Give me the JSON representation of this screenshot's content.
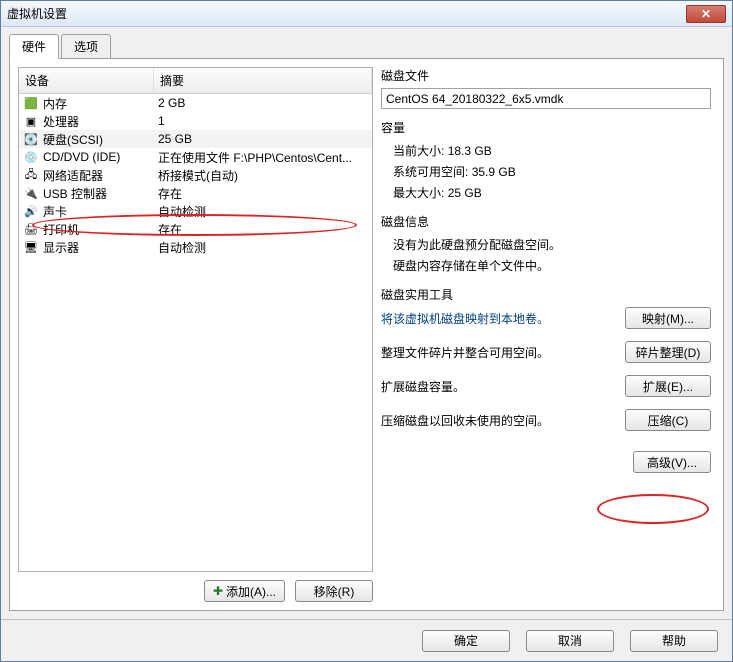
{
  "window": {
    "title": "虚拟机设置",
    "close_glyph": "✕"
  },
  "tabs": {
    "hardware": "硬件",
    "options": "选项"
  },
  "device_table": {
    "head_device": "设备",
    "head_summary": "摘要",
    "rows": [
      {
        "icon": "🟩",
        "name": "内存",
        "summary": "2 GB"
      },
      {
        "icon": "▣",
        "name": "处理器",
        "summary": "1"
      },
      {
        "icon": "💽",
        "name": "硬盘(SCSI)",
        "summary": "25 GB",
        "selected": true
      },
      {
        "icon": "💿",
        "name": "CD/DVD (IDE)",
        "summary": "正在使用文件 F:\\PHP\\Centos\\Cent..."
      },
      {
        "icon": "🖧",
        "name": "网络适配器",
        "summary": "桥接模式(自动)"
      },
      {
        "icon": "🔌",
        "name": "USB 控制器",
        "summary": "存在"
      },
      {
        "icon": "🔊",
        "name": "声卡",
        "summary": "自动检测"
      },
      {
        "icon": "🖨",
        "name": "打印机",
        "summary": "存在"
      },
      {
        "icon": "🖥",
        "name": "显示器",
        "summary": "自动检测"
      }
    ]
  },
  "left_buttons": {
    "add": "添加(A)...",
    "remove": "移除(R)"
  },
  "disk_file": {
    "label": "磁盘文件",
    "value": "CentOS 64_20180322_6x5.vmdk"
  },
  "capacity": {
    "label": "容量",
    "current_size_label": "当前大小:",
    "current_size": "18.3 GB",
    "free_label": "系统可用空间:",
    "free": "35.9 GB",
    "max_label": "最大大小:",
    "max": "25 GB"
  },
  "disk_info": {
    "label": "磁盘信息",
    "no_prealloc": "没有为此硬盘预分配磁盘空间。",
    "single_file": "硬盘内容存储在单个文件中。"
  },
  "utilities": {
    "label": "磁盘实用工具",
    "map_desc": "将该虚拟机磁盘映射到本地卷。",
    "map_btn": "映射(M)...",
    "defrag_desc": "整理文件碎片并整合可用空间。",
    "defrag_btn": "碎片整理(D)",
    "expand_desc": "扩展磁盘容量。",
    "expand_btn": "扩展(E)...",
    "compact_desc": "压缩磁盘以回收未使用的空间。",
    "compact_btn": "压缩(C)",
    "advanced_btn": "高级(V)..."
  },
  "footer": {
    "ok": "确定",
    "cancel": "取消",
    "help": "帮助"
  }
}
